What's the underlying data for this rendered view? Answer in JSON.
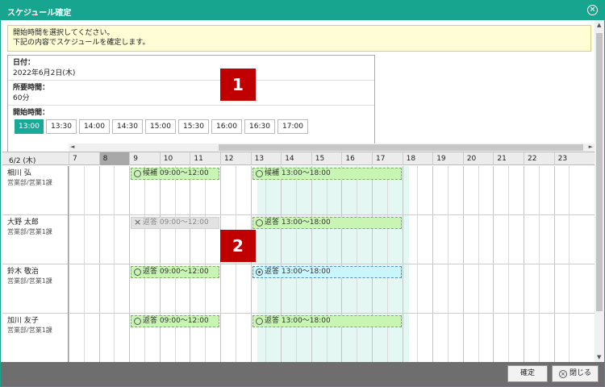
{
  "dialog": {
    "title": "スケジュール確定",
    "close_icon": "circle-x-icon"
  },
  "notice": {
    "line1": "開始時間を選択してください。",
    "line2": "下記の内容でスケジュールを確定します。"
  },
  "info": {
    "date_label": "日付：",
    "date_value": "2022年6月2日(木)",
    "duration_label": "所要時間：",
    "duration_value": "60分",
    "start_label": "開始時間：",
    "start_times": [
      "13:00",
      "13:30",
      "14:00",
      "14:30",
      "15:00",
      "15:30",
      "16:00",
      "16:30",
      "17:00"
    ],
    "selected_time": "13:00"
  },
  "badges": [
    "1",
    "2"
  ],
  "schedule": {
    "date_header": "6/2 (木)",
    "hours": [
      "7",
      "8",
      "9",
      "10",
      "11",
      "12",
      "13",
      "14",
      "15",
      "16",
      "17",
      "18",
      "19",
      "20",
      "21",
      "22",
      "23"
    ],
    "people": [
      {
        "name": "相川 弘",
        "dept": "営業部/営業1課",
        "events": [
          {
            "label": "候補 09:00～12:00",
            "status": "candidate"
          },
          {
            "label": "候補 13:00～18:00",
            "status": "candidate"
          }
        ]
      },
      {
        "name": "大野 太郎",
        "dept": "営業部/営業1課",
        "events": [
          {
            "label": "返答 09:00～12:00",
            "status": "declined"
          },
          {
            "label": "返答 13:00～18:00",
            "status": "ok"
          }
        ]
      },
      {
        "name": "鈴木 敬治",
        "dept": "営業部/営業1課",
        "events": [
          {
            "label": "返答 09:00～12:00",
            "status": "ok"
          },
          {
            "label": "返答 13:00～18:00",
            "status": "self"
          }
        ]
      },
      {
        "name": "加川 友子",
        "dept": "営業部/営業1課",
        "events": [
          {
            "label": "返答 09:00～12:00",
            "status": "ok"
          },
          {
            "label": "返答 13:00～18:00",
            "status": "ok"
          }
        ]
      }
    ]
  },
  "footer": {
    "confirm": "確定",
    "close": "閉じる",
    "close_icon": "circle-x-icon"
  },
  "colors": {
    "accent": "#18a590",
    "candidate": "#c8f5b3",
    "self": "#c9f6fb",
    "declined": "#e2e2e2",
    "badge": "#c00000"
  }
}
